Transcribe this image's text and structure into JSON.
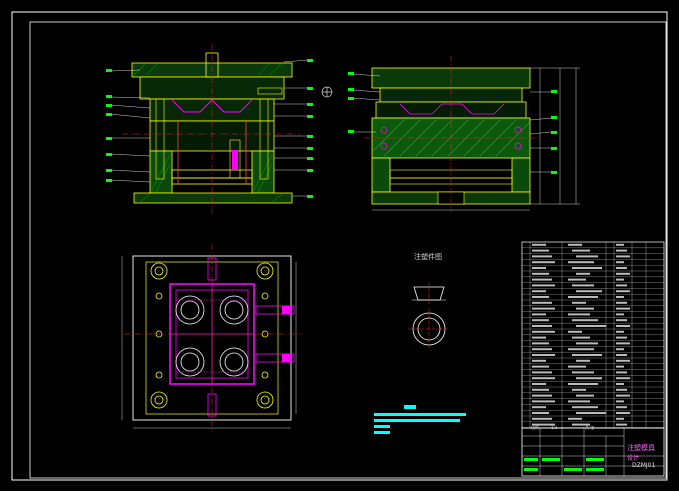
{
  "drawing": {
    "part_view_title": "注塑件图",
    "title_block": {
      "name": "注塑模具",
      "name_line2": "设计",
      "drawing_number": "DZMJ01",
      "scale_label": "比例",
      "scale_value": "1:1",
      "sheet_label": "共 张"
    }
  },
  "colors": {
    "background": "#000000",
    "frame": "#ffffff",
    "steel": "#00ff00",
    "outline": "#ffff00",
    "cavity": "#ff00ff",
    "centerline": "#ff2020",
    "cooling": "#ff00ff",
    "text_block": "#00ffff"
  }
}
